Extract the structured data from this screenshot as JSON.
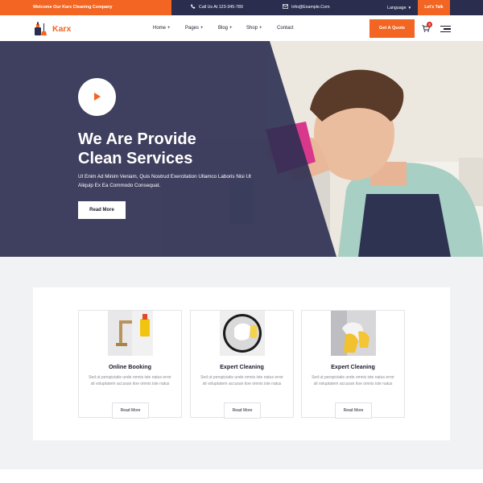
{
  "topbar": {
    "welcome": "Welcome Our Karx Cleaning Company",
    "phone": "Call Us At 123-345-789",
    "email": "Info@Example.Com",
    "language": "Language",
    "talk_button": "Let's Talk"
  },
  "header": {
    "logo_text": "Karx",
    "nav": [
      {
        "label": "Home",
        "has_submenu": true
      },
      {
        "label": "Pages",
        "has_submenu": true
      },
      {
        "label": "Blog",
        "has_submenu": true
      },
      {
        "label": "Shop",
        "has_submenu": true
      },
      {
        "label": "Contact",
        "has_submenu": false
      }
    ],
    "submenu_glyph": "+",
    "quote_button": "Get A Quote",
    "cart_count": "0"
  },
  "hero": {
    "title_line1": "We Are Provide",
    "title_line2": "Clean Services",
    "description": "Ut Enim Ad Minim Veniam, Quis Nostrud Exercitation Ullamco Laboris Nisi Ut Aliquip Ex Ea Commodo Consequat.",
    "button": "Read More"
  },
  "services": [
    {
      "title": "Online Booking",
      "text": "Sed ut perspiciatis unde omnis iste natus error sit voluptatem accusan tioe omnis iste natus",
      "button": "Read More"
    },
    {
      "title": "Expert Cleaning",
      "text": "Sed ut perspiciatis unde omnis iste natus error sit voluptatem accusan tioe omnis iste natus",
      "button": "Read More"
    },
    {
      "title": "Expert Cleaning",
      "text": "Sed ut perspiciatis unde omnis iste natus error sit voluptatem accusan tioe omnis iste natus",
      "button": "Read More"
    }
  ],
  "colors": {
    "accent": "#f26522",
    "navy": "#2b2d4e",
    "hero_overlay": "#2c2f52",
    "panel_bg": "#f1f2f4"
  },
  "icons": {
    "phone": "phone-icon",
    "email": "envelope-icon",
    "cart": "cart-icon",
    "menu": "hamburger-menu-icon",
    "play": "play-icon"
  }
}
